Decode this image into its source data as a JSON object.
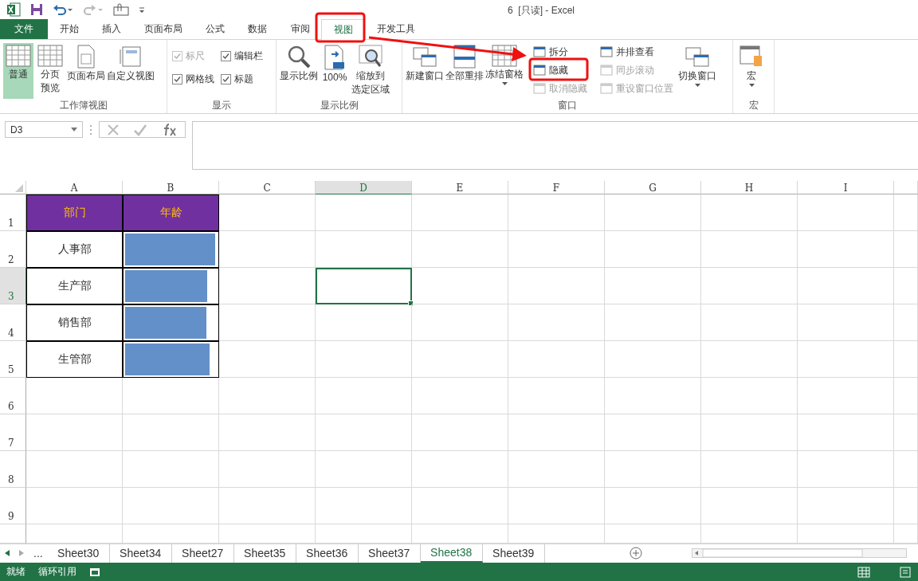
{
  "window": {
    "title": "6  [只读] - Excel"
  },
  "tabs": [
    {
      "label": "文件",
      "kind": "file",
      "selected": false
    },
    {
      "label": "开始",
      "kind": "tab",
      "selected": false
    },
    {
      "label": "插入",
      "kind": "tab",
      "selected": false
    },
    {
      "label": "页面布局",
      "kind": "tab",
      "selected": false
    },
    {
      "label": "公式",
      "kind": "tab",
      "selected": false
    },
    {
      "label": "数据",
      "kind": "tab",
      "selected": false
    },
    {
      "label": "审阅",
      "kind": "tab",
      "selected": false
    },
    {
      "label": "视图",
      "kind": "tab",
      "selected": true
    },
    {
      "label": "开发工具",
      "kind": "tab",
      "selected": false
    }
  ],
  "ribbon": {
    "groups": [
      {
        "label": "工作簿视图",
        "items": [
          {
            "kind": "large",
            "label": "普通",
            "selected": true
          },
          {
            "kind": "large",
            "lines": [
              "分页",
              "预览"
            ],
            "selected": false
          },
          {
            "kind": "large",
            "label": "页面布局",
            "selected": false
          },
          {
            "kind": "large",
            "label": "自定义视图",
            "selected": false
          }
        ]
      },
      {
        "label": "显示",
        "items": [
          {
            "kind": "check",
            "label": "标尺",
            "checked": true,
            "disabled": true
          },
          {
            "kind": "check",
            "label": "编辑栏",
            "checked": true,
            "disabled": false
          },
          {
            "kind": "check",
            "label": "网格线",
            "checked": true,
            "disabled": false
          },
          {
            "kind": "check",
            "label": "标题",
            "checked": true,
            "disabled": false
          }
        ]
      },
      {
        "label": "显示比例",
        "items": [
          {
            "kind": "large",
            "label": "显示比例",
            "selected": false
          },
          {
            "kind": "large",
            "label": "100%",
            "selected": false
          },
          {
            "kind": "large",
            "lines": [
              "缩放到",
              "选定区域"
            ],
            "selected": false
          }
        ]
      },
      {
        "label": "窗口",
        "items": [
          {
            "kind": "large",
            "label": "新建窗口",
            "selected": false
          },
          {
            "kind": "large",
            "label": "全部重排",
            "selected": false
          },
          {
            "kind": "dropdown",
            "label": "冻结窗格",
            "selected": false
          },
          {
            "kind": "small",
            "label": "拆分",
            "disabled": false
          },
          {
            "kind": "small",
            "label": "隐藏",
            "disabled": false
          },
          {
            "kind": "small",
            "label": "取消隐藏",
            "disabled": true
          },
          {
            "kind": "small",
            "label": "并排查看",
            "disabled": false
          },
          {
            "kind": "small",
            "label": "同步滚动",
            "disabled": true
          },
          {
            "kind": "small",
            "label": "重设窗口位置",
            "disabled": true
          },
          {
            "kind": "dropdown",
            "label": "切换窗口",
            "selected": false
          }
        ]
      },
      {
        "label": "宏",
        "items": [
          {
            "kind": "dropdown",
            "label": "宏",
            "selected": false
          }
        ]
      }
    ]
  },
  "formula_bar": {
    "name_box": "D3"
  },
  "sheet": {
    "columns": [
      {
        "label": "A",
        "selected": false
      },
      {
        "label": "B",
        "selected": false
      },
      {
        "label": "C",
        "selected": false
      },
      {
        "label": "D",
        "selected": true
      },
      {
        "label": "E",
        "selected": false
      },
      {
        "label": "F",
        "selected": false
      },
      {
        "label": "G",
        "selected": false
      },
      {
        "label": "H",
        "selected": false
      },
      {
        "label": "I",
        "selected": false
      }
    ],
    "row_numbers": [
      {
        "label": "1",
        "selected": false
      },
      {
        "label": "2",
        "selected": false
      },
      {
        "label": "3",
        "selected": true
      },
      {
        "label": "4",
        "selected": false
      },
      {
        "label": "5",
        "selected": false
      },
      {
        "label": "6",
        "selected": false
      },
      {
        "label": "7",
        "selected": false
      },
      {
        "label": "8",
        "selected": false
      },
      {
        "label": "9",
        "selected": false
      }
    ],
    "rows": [
      [
        {
          "kind": "header",
          "text": "部门"
        },
        {
          "kind": "header",
          "text": "年龄"
        }
      ],
      [
        {
          "kind": "text",
          "text": "人事部"
        },
        {
          "kind": "databar",
          "level": 0.97
        }
      ],
      [
        {
          "kind": "text",
          "text": "生产部"
        },
        {
          "kind": "databar",
          "level": 0.88
        }
      ],
      [
        {
          "kind": "text",
          "text": "销售部"
        },
        {
          "kind": "databar",
          "level": 0.87
        }
      ],
      [
        {
          "kind": "text",
          "text": "生管部"
        },
        {
          "kind": "databar",
          "level": 0.91
        }
      ]
    ]
  },
  "sheet_tabs": {
    "more": "...",
    "tabs": [
      {
        "label": "Sheet30",
        "selected": false
      },
      {
        "label": "Sheet34",
        "selected": false
      },
      {
        "label": "Sheet27",
        "selected": false
      },
      {
        "label": "Sheet35",
        "selected": false
      },
      {
        "label": "Sheet36",
        "selected": false
      },
      {
        "label": "Sheet37",
        "selected": false
      },
      {
        "label": "Sheet38",
        "selected": true
      },
      {
        "label": "Sheet39",
        "selected": false
      }
    ]
  },
  "status_bar": {
    "items": [
      "就绪",
      "循环引用"
    ]
  }
}
